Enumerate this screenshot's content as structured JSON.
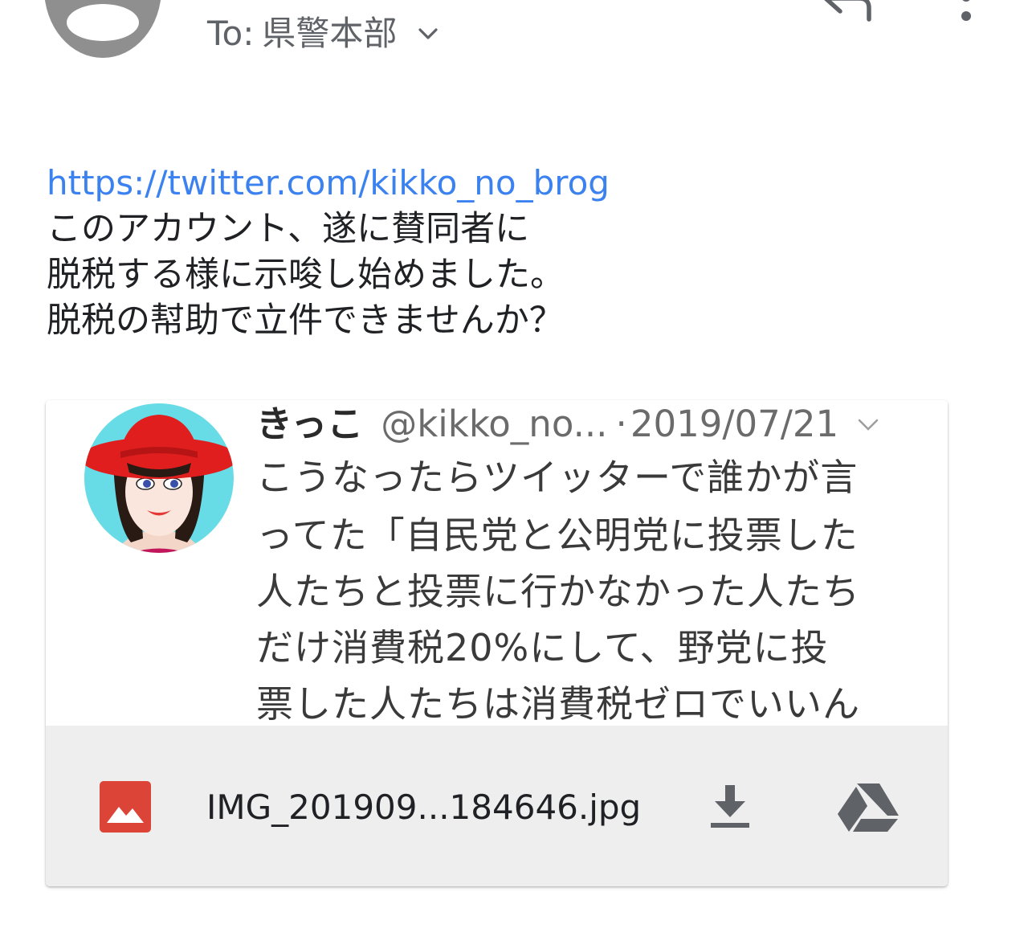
{
  "header": {
    "to_prefix": "To:",
    "recipient": "県警本部",
    "icons": [
      "sender-avatar-icon",
      "chevron-down-icon",
      "reply-icon",
      "more-vert-icon"
    ]
  },
  "message": {
    "link": "https://twitter.com/kikko_no_brog",
    "lines": [
      "このアカウント、遂に賛同者に",
      "脱税する様に示唆し始めました。",
      "脱税の幇助で立件できませんか？"
    ],
    "link_color": "#3b82f0"
  },
  "attachment": {
    "preview": {
      "name": "きっこ",
      "handle": "@kikko_no...",
      "separator": "·",
      "date": "2019/07/21",
      "lines": [
        "こうなったらツイッターで誰かが言",
        "ってた「自民党と公明党に投票した",
        "人たちと投票に行かなかった人たち",
        "だけ消費税20%にして、野党に投",
        "票した人たちは消費税ゼロでいいん"
      ]
    },
    "file_name": "IMG_201909...184646.jpg",
    "icons": [
      "image-file-icon",
      "download-icon",
      "drive-icon"
    ],
    "image_icon_color": "#db4437",
    "bar_color": "#eeeeee"
  }
}
